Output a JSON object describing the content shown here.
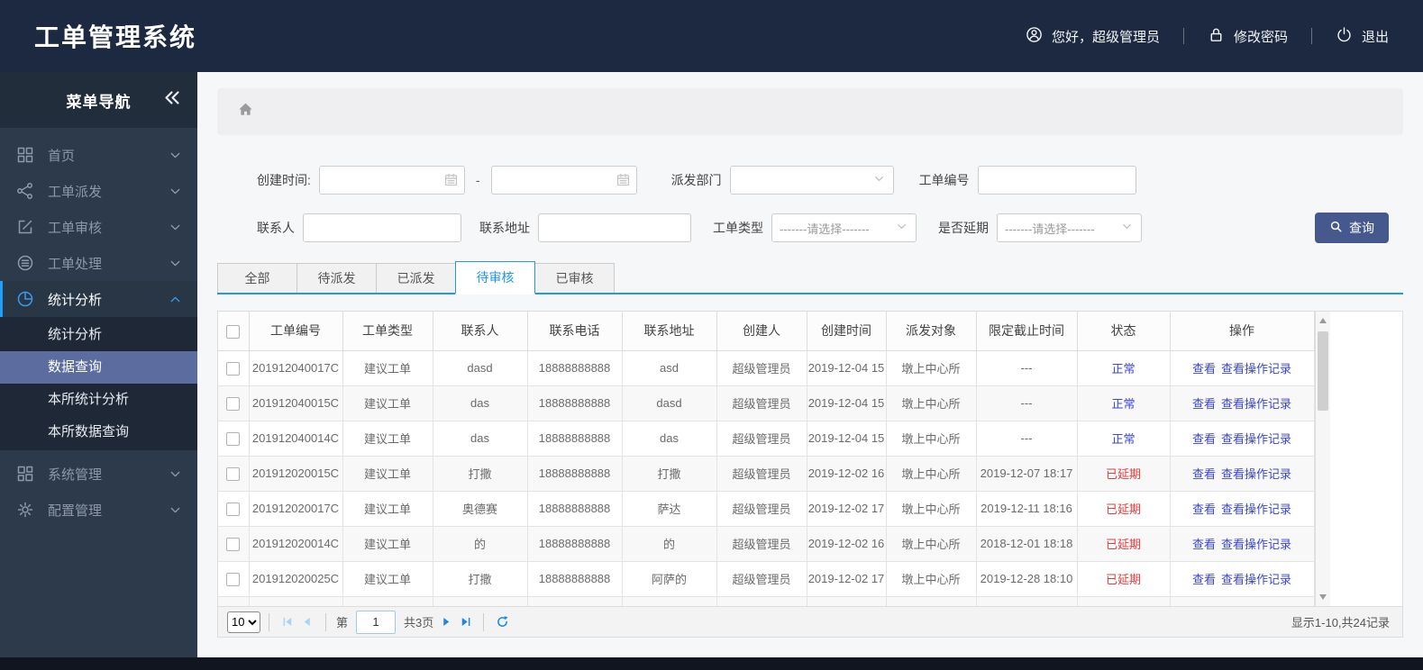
{
  "app": {
    "title": "工单管理系统"
  },
  "header": {
    "greeting": "您好，超级管理员",
    "change_password": "修改密码",
    "logout": "退出"
  },
  "sidebar": {
    "title": "菜单导航",
    "items": [
      {
        "label": "首页",
        "icon": "grid-icon",
        "expanded": false,
        "active": false
      },
      {
        "label": "工单派发",
        "icon": "share-icon",
        "expanded": false,
        "active": false
      },
      {
        "label": "工单审核",
        "icon": "edit-icon",
        "expanded": false,
        "active": false
      },
      {
        "label": "工单处理",
        "icon": "process-icon",
        "expanded": false,
        "active": false
      },
      {
        "label": "统计分析",
        "icon": "pie-icon",
        "expanded": true,
        "active": true,
        "children": [
          {
            "label": "统计分析",
            "active": false
          },
          {
            "label": "数据查询",
            "active": true
          },
          {
            "label": "本所统计分析",
            "active": false
          },
          {
            "label": "本所数据查询",
            "active": false
          }
        ]
      },
      {
        "label": "系统管理",
        "icon": "modules-icon",
        "expanded": false,
        "active": false
      },
      {
        "label": "配置管理",
        "icon": "gear-icon",
        "expanded": false,
        "active": false
      }
    ]
  },
  "search": {
    "create_time_label": "创建时间:",
    "range_separator": "-",
    "dispatch_dept_label": "派发部门",
    "order_no_label": "工单编号",
    "contact_label": "联系人",
    "address_label": "联系地址",
    "order_type_label": "工单类型",
    "delay_label": "是否延期",
    "select_placeholder": "-------请选择-------",
    "query_button": "查询"
  },
  "tabs": [
    {
      "label": "全部",
      "active": false
    },
    {
      "label": "待派发",
      "active": false
    },
    {
      "label": "已派发",
      "active": false
    },
    {
      "label": "待审核",
      "active": true
    },
    {
      "label": "已审核",
      "active": false
    }
  ],
  "table": {
    "columns": [
      "工单编号",
      "工单类型",
      "联系人",
      "联系电话",
      "联系地址",
      "创建人",
      "创建时间",
      "派发对象",
      "限定截止时间",
      "状态",
      "操作"
    ],
    "action_labels": [
      "查看",
      "查看操作记录"
    ],
    "rows": [
      {
        "order_no": "201912040017C",
        "type": "建议工单",
        "contact": "dasd",
        "phone": "18888888888",
        "address": "asd",
        "creator": "超级管理员",
        "created": "2019-12-04 15",
        "target": "墩上中心所",
        "deadline": "---",
        "status": "正常",
        "status_kind": "normal"
      },
      {
        "order_no": "201912040015C",
        "type": "建议工单",
        "contact": "das",
        "phone": "18888888888",
        "address": "dasd",
        "creator": "超级管理员",
        "created": "2019-12-04 15",
        "target": "墩上中心所",
        "deadline": "---",
        "status": "正常",
        "status_kind": "normal"
      },
      {
        "order_no": "201912040014C",
        "type": "建议工单",
        "contact": "das",
        "phone": "18888888888",
        "address": "das",
        "creator": "超级管理员",
        "created": "2019-12-04 15",
        "target": "墩上中心所",
        "deadline": "---",
        "status": "正常",
        "status_kind": "normal"
      },
      {
        "order_no": "201912020015C",
        "type": "建议工单",
        "contact": "打撒",
        "phone": "18888888888",
        "address": "打撒",
        "creator": "超级管理员",
        "created": "2019-12-02 16",
        "target": "墩上中心所",
        "deadline": "2019-12-07 18:17",
        "status": "已延期",
        "status_kind": "delayed"
      },
      {
        "order_no": "201912020017C",
        "type": "建议工单",
        "contact": "奥德赛",
        "phone": "18888888888",
        "address": "萨达",
        "creator": "超级管理员",
        "created": "2019-12-02 17",
        "target": "墩上中心所",
        "deadline": "2019-12-11 18:16",
        "status": "已延期",
        "status_kind": "delayed"
      },
      {
        "order_no": "201912020014C",
        "type": "建议工单",
        "contact": "的",
        "phone": "18888888888",
        "address": "的",
        "creator": "超级管理员",
        "created": "2019-12-02 16",
        "target": "墩上中心所",
        "deadline": "2018-12-01 18:18",
        "status": "已延期",
        "status_kind": "delayed"
      },
      {
        "order_no": "201912020025C",
        "type": "建议工单",
        "contact": "打撒",
        "phone": "18888888888",
        "address": "阿萨的",
        "creator": "超级管理员",
        "created": "2019-12-02 17",
        "target": "墩上中心所",
        "deadline": "2019-12-28 18:10",
        "status": "已延期",
        "status_kind": "delayed"
      }
    ]
  },
  "pagination": {
    "page_size": "10",
    "page_prefix": "第",
    "current_page": "1",
    "total_pages": "共3页",
    "summary": "显示1-10,共24记录"
  },
  "colors": {
    "header_bg": "#1c2940",
    "sidebar_bg": "#2d3a4b",
    "accent_blue": "#2196f3",
    "link_blue": "#3a46d4",
    "status_delayed_red": "#e23b3b",
    "query_button_bg": "#46598f",
    "active_submenu_bg": "#5d6c9e"
  }
}
